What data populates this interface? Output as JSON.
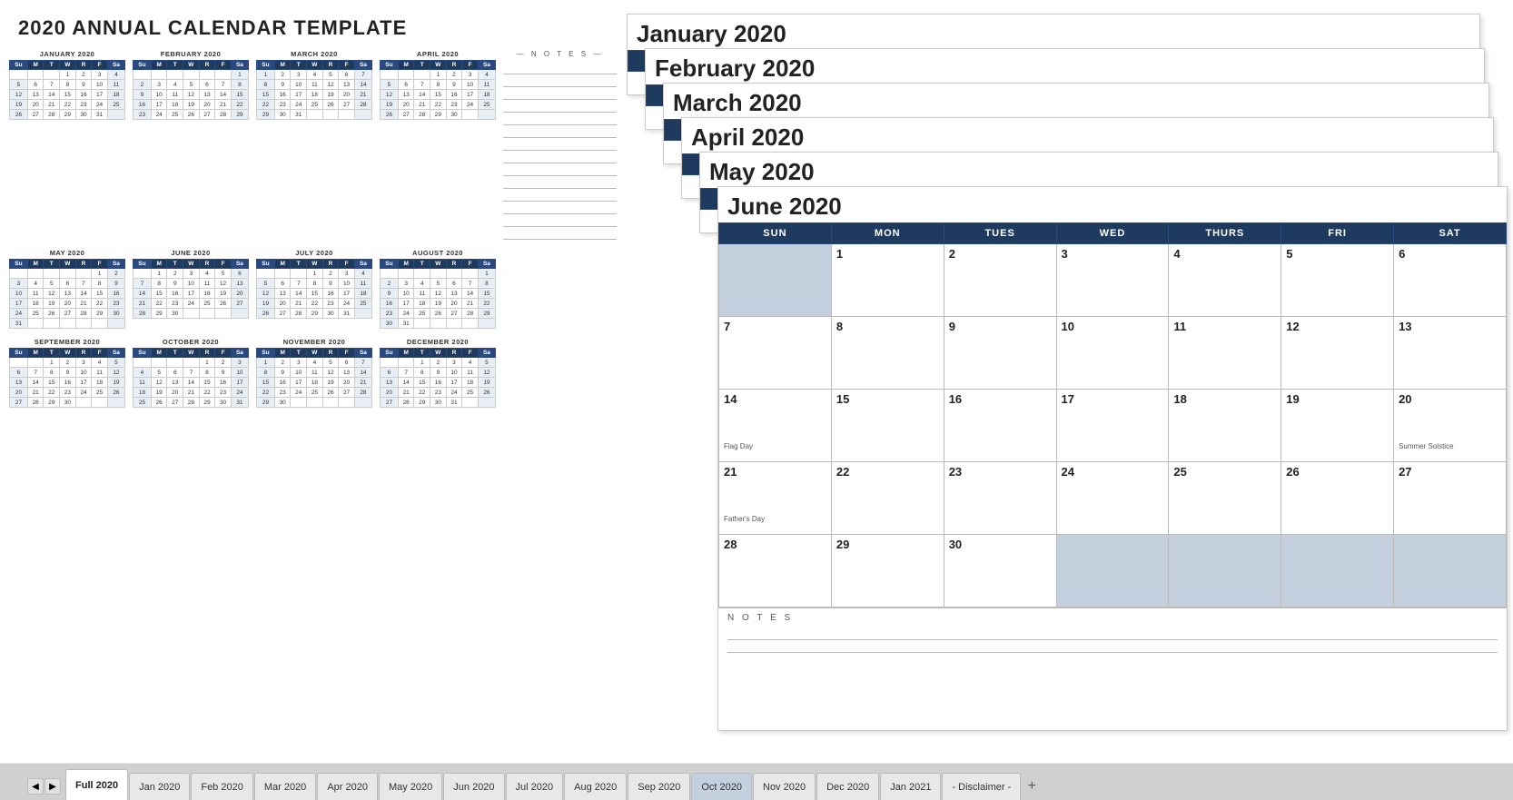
{
  "title": "2020 ANNUAL CALENDAR TEMPLATE",
  "miniCalendars": [
    {
      "id": "jan2020",
      "title": "JANUARY 2020",
      "headers": [
        "Su",
        "M",
        "T",
        "W",
        "R",
        "F",
        "Sa"
      ],
      "weeks": [
        [
          "",
          "",
          "",
          "1",
          "2",
          "3",
          "4"
        ],
        [
          "5",
          "6",
          "7",
          "8",
          "9",
          "10",
          "11"
        ],
        [
          "12",
          "13",
          "14",
          "15",
          "16",
          "17",
          "18"
        ],
        [
          "19",
          "20",
          "21",
          "22",
          "23",
          "24",
          "25"
        ],
        [
          "26",
          "27",
          "28",
          "29",
          "30",
          "31",
          ""
        ]
      ]
    },
    {
      "id": "feb2020",
      "title": "FEBRUARY 2020",
      "headers": [
        "Su",
        "M",
        "T",
        "W",
        "R",
        "F",
        "Sa"
      ],
      "weeks": [
        [
          "",
          "",
          "",
          "",
          "",
          "",
          "1"
        ],
        [
          "2",
          "3",
          "4",
          "5",
          "6",
          "7",
          "8"
        ],
        [
          "9",
          "10",
          "11",
          "12",
          "13",
          "14",
          "15"
        ],
        [
          "16",
          "17",
          "18",
          "19",
          "20",
          "21",
          "22"
        ],
        [
          "23",
          "24",
          "25",
          "26",
          "27",
          "28",
          "29"
        ]
      ]
    },
    {
      "id": "mar2020",
      "title": "MARCH 2020",
      "headers": [
        "Su",
        "M",
        "T",
        "W",
        "R",
        "F",
        "Sa"
      ],
      "weeks": [
        [
          "1",
          "2",
          "3",
          "4",
          "5",
          "6",
          "7"
        ],
        [
          "8",
          "9",
          "10",
          "11",
          "12",
          "13",
          "14"
        ],
        [
          "15",
          "16",
          "17",
          "18",
          "19",
          "20",
          "21"
        ],
        [
          "22",
          "23",
          "24",
          "25",
          "26",
          "27",
          "28"
        ],
        [
          "29",
          "30",
          "31",
          "",
          "",
          "",
          ""
        ]
      ]
    },
    {
      "id": "apr2020",
      "title": "APRIL 2020",
      "headers": [
        "Su",
        "M",
        "T",
        "W",
        "R",
        "F",
        "Sa"
      ],
      "weeks": [
        [
          "",
          "",
          "",
          "1",
          "2",
          "3",
          "4"
        ],
        [
          "5",
          "6",
          "7",
          "8",
          "9",
          "10",
          "11"
        ],
        [
          "12",
          "13",
          "14",
          "15",
          "16",
          "17",
          "18"
        ],
        [
          "19",
          "20",
          "21",
          "22",
          "23",
          "24",
          "25"
        ],
        [
          "26",
          "27",
          "28",
          "29",
          "30",
          "",
          ""
        ]
      ]
    },
    {
      "id": "may2020",
      "title": "MAY 2020",
      "headers": [
        "Su",
        "M",
        "T",
        "W",
        "R",
        "F",
        "Sa"
      ],
      "weeks": [
        [
          "",
          "",
          "",
          "",
          "",
          "1",
          "2"
        ],
        [
          "3",
          "4",
          "5",
          "6",
          "7",
          "8",
          "9"
        ],
        [
          "10",
          "11",
          "12",
          "13",
          "14",
          "15",
          "16"
        ],
        [
          "17",
          "18",
          "19",
          "20",
          "21",
          "22",
          "23"
        ],
        [
          "24",
          "25",
          "26",
          "27",
          "28",
          "29",
          "30"
        ],
        [
          "31",
          "",
          "",
          "",
          "",
          "",
          ""
        ]
      ]
    },
    {
      "id": "jun2020",
      "title": "JUNE 2020",
      "headers": [
        "Su",
        "M",
        "T",
        "W",
        "R",
        "F",
        "Sa"
      ],
      "weeks": [
        [
          "",
          "1",
          "2",
          "3",
          "4",
          "5",
          "6"
        ],
        [
          "7",
          "8",
          "9",
          "10",
          "11",
          "12",
          "13"
        ],
        [
          "14",
          "15",
          "16",
          "17",
          "18",
          "19",
          "20"
        ],
        [
          "21",
          "22",
          "23",
          "24",
          "25",
          "26",
          "27"
        ],
        [
          "28",
          "29",
          "30",
          "",
          "",
          "",
          ""
        ]
      ]
    },
    {
      "id": "jul2020",
      "title": "JULY 2020",
      "headers": [
        "Su",
        "M",
        "T",
        "W",
        "R",
        "F",
        "Sa"
      ],
      "weeks": [
        [
          "",
          "",
          "",
          "1",
          "2",
          "3",
          "4"
        ],
        [
          "5",
          "6",
          "7",
          "8",
          "9",
          "10",
          "11"
        ],
        [
          "12",
          "13",
          "14",
          "15",
          "16",
          "17",
          "18"
        ],
        [
          "19",
          "20",
          "21",
          "22",
          "23",
          "24",
          "25"
        ],
        [
          "26",
          "27",
          "28",
          "29",
          "30",
          "31",
          ""
        ]
      ]
    },
    {
      "id": "aug2020",
      "title": "AUGUST 2020",
      "headers": [
        "Su",
        "M",
        "T",
        "W",
        "R",
        "F",
        "Sa"
      ],
      "weeks": [
        [
          "",
          "",
          "",
          "",
          "",
          "",
          "1"
        ],
        [
          "2",
          "3",
          "4",
          "5",
          "6",
          "7",
          "8"
        ],
        [
          "9",
          "10",
          "11",
          "12",
          "13",
          "14",
          "15"
        ],
        [
          "16",
          "17",
          "18",
          "19",
          "20",
          "21",
          "22"
        ],
        [
          "23",
          "24",
          "25",
          "26",
          "27",
          "28",
          "29"
        ],
        [
          "30",
          "31",
          "",
          "",
          "",
          "",
          ""
        ]
      ]
    },
    {
      "id": "sep2020",
      "title": "SEPTEMBER 2020",
      "headers": [
        "Su",
        "M",
        "T",
        "W",
        "R",
        "F",
        "Sa"
      ],
      "weeks": [
        [
          "",
          "",
          "1",
          "2",
          "3",
          "4",
          "5"
        ],
        [
          "6",
          "7",
          "8",
          "9",
          "10",
          "11",
          "12"
        ],
        [
          "13",
          "14",
          "15",
          "16",
          "17",
          "18",
          "19"
        ],
        [
          "20",
          "21",
          "22",
          "23",
          "24",
          "25",
          "26"
        ],
        [
          "27",
          "28",
          "29",
          "30",
          "",
          "",
          ""
        ]
      ]
    },
    {
      "id": "oct2020",
      "title": "OCTOBER 2020",
      "headers": [
        "Su",
        "M",
        "T",
        "W",
        "R",
        "F",
        "Sa"
      ],
      "weeks": [
        [
          "",
          "",
          "",
          "",
          "1",
          "2",
          "3"
        ],
        [
          "4",
          "5",
          "6",
          "7",
          "8",
          "9",
          "10"
        ],
        [
          "11",
          "12",
          "13",
          "14",
          "15",
          "16",
          "17"
        ],
        [
          "18",
          "19",
          "20",
          "21",
          "22",
          "23",
          "24"
        ],
        [
          "25",
          "26",
          "27",
          "28",
          "29",
          "30",
          "31"
        ]
      ]
    },
    {
      "id": "nov2020",
      "title": "NOVEMBER 2020",
      "headers": [
        "Su",
        "M",
        "T",
        "W",
        "R",
        "F",
        "Sa"
      ],
      "weeks": [
        [
          "1",
          "2",
          "3",
          "4",
          "5",
          "6",
          "7"
        ],
        [
          "8",
          "9",
          "10",
          "11",
          "12",
          "13",
          "14"
        ],
        [
          "15",
          "16",
          "17",
          "18",
          "19",
          "20",
          "21"
        ],
        [
          "22",
          "23",
          "24",
          "25",
          "26",
          "27",
          "28"
        ],
        [
          "29",
          "30",
          "",
          "",
          "",
          "",
          ""
        ]
      ]
    },
    {
      "id": "dec2020",
      "title": "DECEMBER 2020",
      "headers": [
        "Su",
        "M",
        "T",
        "W",
        "R",
        "F",
        "Sa"
      ],
      "weeks": [
        [
          "",
          "",
          "1",
          "2",
          "3",
          "4",
          "5"
        ],
        [
          "6",
          "7",
          "8",
          "9",
          "10",
          "11",
          "12"
        ],
        [
          "13",
          "14",
          "15",
          "16",
          "17",
          "18",
          "19"
        ],
        [
          "20",
          "21",
          "22",
          "23",
          "24",
          "25",
          "26"
        ],
        [
          "27",
          "28",
          "29",
          "30",
          "31",
          "",
          ""
        ]
      ]
    }
  ],
  "stackedCalendars": [
    {
      "id": "sc-jan",
      "title": "January 2020"
    },
    {
      "id": "sc-feb",
      "title": "February 2020"
    },
    {
      "id": "sc-mar",
      "title": "March 2020"
    },
    {
      "id": "sc-apr",
      "title": "April 2020"
    },
    {
      "id": "sc-may",
      "title": "May 2020"
    },
    {
      "id": "sc-jun",
      "title": "June 2020"
    }
  ],
  "junCalHeaders": [
    "SUN",
    "MON",
    "TUES",
    "WED",
    "THURS",
    "FRI",
    "SAT"
  ],
  "junCalWeeks": [
    [
      {
        "num": "",
        "note": "",
        "shaded": true
      },
      {
        "num": "1",
        "note": "",
        "shaded": false
      },
      {
        "num": "2",
        "note": "",
        "shaded": false
      },
      {
        "num": "3",
        "note": "",
        "shaded": false
      },
      {
        "num": "4",
        "note": "",
        "shaded": false
      },
      {
        "num": "5",
        "note": "",
        "shaded": false
      },
      {
        "num": "6",
        "note": "",
        "shaded": false
      }
    ],
    [
      {
        "num": "7",
        "note": "",
        "shaded": false
      },
      {
        "num": "8",
        "note": "",
        "shaded": false
      },
      {
        "num": "9",
        "note": "",
        "shaded": false
      },
      {
        "num": "10",
        "note": "",
        "shaded": false
      },
      {
        "num": "11",
        "note": "",
        "shaded": false
      },
      {
        "num": "12",
        "note": "",
        "shaded": false
      },
      {
        "num": "13",
        "note": "",
        "shaded": false
      }
    ],
    [
      {
        "num": "14",
        "note": "",
        "shaded": false
      },
      {
        "num": "15",
        "note": "",
        "shaded": false
      },
      {
        "num": "16",
        "note": "",
        "shaded": false
      },
      {
        "num": "17",
        "note": "",
        "shaded": false
      },
      {
        "num": "18",
        "note": "",
        "shaded": false
      },
      {
        "num": "19",
        "note": "",
        "shaded": false
      },
      {
        "num": "20",
        "note": "Summer Solstice",
        "shaded": false
      }
    ],
    [
      {
        "num": "21",
        "note": "Father's Day",
        "shaded": false
      },
      {
        "num": "22",
        "note": "",
        "shaded": false
      },
      {
        "num": "23",
        "note": "",
        "shaded": false
      },
      {
        "num": "24",
        "note": "",
        "shaded": false
      },
      {
        "num": "25",
        "note": "",
        "shaded": false
      },
      {
        "num": "26",
        "note": "",
        "shaded": false
      },
      {
        "num": "27",
        "note": "",
        "shaded": false
      }
    ],
    [
      {
        "num": "28",
        "note": "",
        "shaded": false
      },
      {
        "num": "29",
        "note": "",
        "shaded": false
      },
      {
        "num": "30",
        "note": "",
        "shaded": false
      },
      {
        "num": "",
        "note": "",
        "shaded": true
      },
      {
        "num": "",
        "note": "",
        "shaded": true
      },
      {
        "num": "",
        "note": "",
        "shaded": true
      },
      {
        "num": "",
        "note": "",
        "shaded": true
      }
    ]
  ],
  "flagDayNote": "Flag Day",
  "notesLabel": "N O T E S",
  "tabs": [
    {
      "label": "Full 2020",
      "active": true,
      "highlighted": false
    },
    {
      "label": "Jan 2020",
      "active": false,
      "highlighted": false
    },
    {
      "label": "Feb 2020",
      "active": false,
      "highlighted": false
    },
    {
      "label": "Mar 2020",
      "active": false,
      "highlighted": false
    },
    {
      "label": "Apr 2020",
      "active": false,
      "highlighted": false
    },
    {
      "label": "May 2020",
      "active": false,
      "highlighted": false
    },
    {
      "label": "Jun 2020",
      "active": false,
      "highlighted": false
    },
    {
      "label": "Jul 2020",
      "active": false,
      "highlighted": false
    },
    {
      "label": "Aug 2020",
      "active": false,
      "highlighted": false
    },
    {
      "label": "Sep 2020",
      "active": false,
      "highlighted": false
    },
    {
      "label": "Oct 2020",
      "active": false,
      "highlighted": true
    },
    {
      "label": "Nov 2020",
      "active": false,
      "highlighted": false
    },
    {
      "label": "Dec 2020",
      "active": false,
      "highlighted": false
    },
    {
      "label": "Jan 2021",
      "active": false,
      "highlighted": false
    },
    {
      "label": "- Disclaimer -",
      "active": false,
      "highlighted": false
    }
  ]
}
